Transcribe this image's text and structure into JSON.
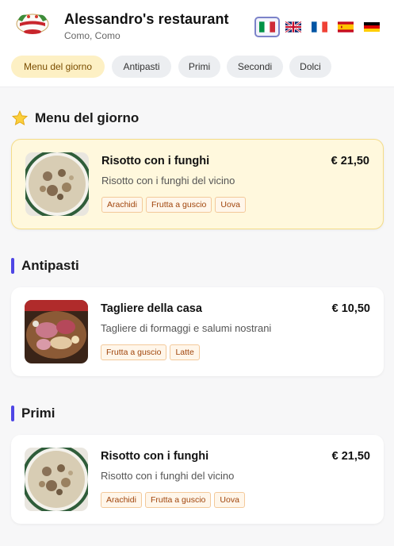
{
  "header": {
    "restaurant_name": "Alessandro's restaurant",
    "location": "Como, Como"
  },
  "languages": [
    {
      "code": "it",
      "icon": "italy-flag-icon",
      "active": true
    },
    {
      "code": "en",
      "icon": "uk-flag-icon",
      "active": false
    },
    {
      "code": "fr",
      "icon": "france-flag-icon",
      "active": false
    },
    {
      "code": "es",
      "icon": "spain-flag-icon",
      "active": false
    },
    {
      "code": "de",
      "icon": "germany-flag-icon",
      "active": false
    }
  ],
  "categories": [
    {
      "label": "Menu del giorno",
      "active": true
    },
    {
      "label": "Antipasti",
      "active": false
    },
    {
      "label": "Primi",
      "active": false
    },
    {
      "label": "Secondi",
      "active": false
    },
    {
      "label": "Dolci",
      "active": false
    }
  ],
  "sections": [
    {
      "title": "Menu del giorno",
      "icon": "star-icon",
      "dishes": [
        {
          "name": "Risotto con i funghi",
          "price": "€ 21,50",
          "description": "Risotto con i funghi del vicino",
          "tags": [
            "Arachidi",
            "Frutta a guscio",
            "Uova"
          ],
          "image": "risotto"
        }
      ]
    },
    {
      "title": "Antipasti",
      "dishes": [
        {
          "name": "Tagliere della casa",
          "price": "€ 10,50",
          "description": "Tagliere di formaggi e salumi nostrani",
          "tags": [
            "Frutta a guscio",
            "Latte"
          ],
          "image": "tagliere"
        }
      ]
    },
    {
      "title": "Primi",
      "dishes": [
        {
          "name": "Risotto con i funghi",
          "price": "€ 21,50",
          "description": "Risotto con i funghi del vicino",
          "tags": [
            "Arachidi",
            "Frutta a guscio",
            "Uova"
          ],
          "image": "risotto"
        }
      ]
    }
  ],
  "colors": {
    "accent": "#4f46e5",
    "featured_bg": "#fff8dd",
    "tag_text": "#a0450c",
    "active_pill": "#fdf0c4"
  }
}
